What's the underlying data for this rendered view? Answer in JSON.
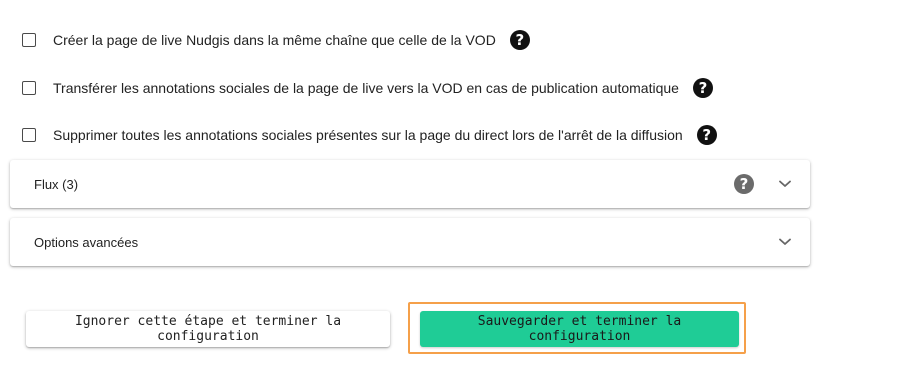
{
  "options": [
    {
      "label": "Créer la page de live Nudgis dans la même chaîne que celle de la VOD",
      "checked": false,
      "help_icon": "question-circle-icon"
    },
    {
      "label": "Transférer les annotations sociales de la page de live vers la VOD en cas de publication automatique",
      "checked": false,
      "help_icon": "question-circle-icon"
    },
    {
      "label": "Supprimer toutes les annotations sociales présentes sur la page du direct lors de l'arrêt de la diffusion",
      "checked": false,
      "help_icon": "question-circle-icon"
    }
  ],
  "panels": [
    {
      "label": "Flux (3)",
      "has_help": true,
      "expanded": false
    },
    {
      "label": "Options avancées",
      "has_help": false,
      "expanded": false
    }
  ],
  "buttons": {
    "skip_label": "Ignorer cette étape et terminer la configuration",
    "save_label": "Sauvegarder et terminer la configuration"
  },
  "colors": {
    "primary": "#1fcc96",
    "highlight": "#f5a04a",
    "help_icon_dark": "#111111",
    "help_icon_grey": "#6b6b6b"
  }
}
